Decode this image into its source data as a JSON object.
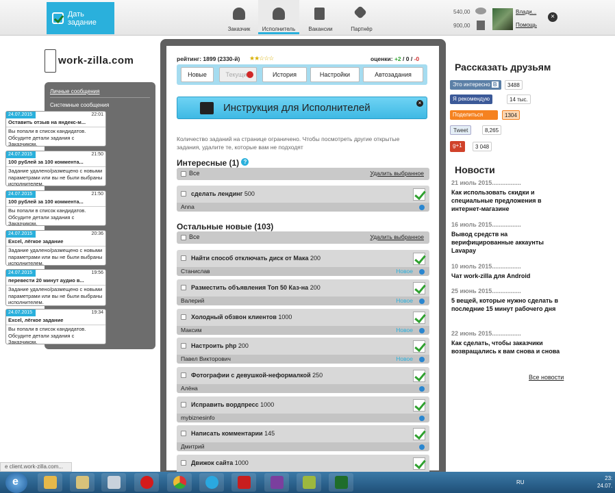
{
  "header": {
    "give_task": "Дать задание",
    "nav": [
      {
        "label": "Заказчик",
        "icon": "person-icon"
      },
      {
        "label": "Исполнитель",
        "icon": "person-icon",
        "active": true
      },
      {
        "label": "Вакансии",
        "icon": "document-icon"
      },
      {
        "label": "Партнёр",
        "icon": "handshake-icon"
      }
    ],
    "balance1": "540,00",
    "balance2": "900,00",
    "user_name": "Влади...",
    "help": "Помощь"
  },
  "logo": {
    "text": "work-zilla.com"
  },
  "messages": {
    "personal_label": "Личные сообщения",
    "system_label": "Системные сообщения",
    "items": [
      {
        "date": "24.07.2015",
        "time": "22:01",
        "title": "Оставить отзыв на яндекс-м...",
        "body": "Вы попали в список кандидатов. Обсудите детали задания с Заказчиком."
      },
      {
        "date": "24.07.2015",
        "time": "21:50",
        "title": "100 рублей за 100 коммента...",
        "body": "Задание удалено/размещено с новыми параметрами или вы не были выбраны исполнителем."
      },
      {
        "date": "24.07.2015",
        "time": "21:50",
        "title": "100 рублей за 100 коммента...",
        "body": "Вы попали в список кандидатов. Обсудите детали задания с Заказчиком."
      },
      {
        "date": "24.07.2015",
        "time": "20:36",
        "title": "Excel, лёгкое задание",
        "body": "Задание удалено/размещено с новыми параметрами или вы не были выбраны исполнителем."
      },
      {
        "date": "24.07.2015",
        "time": "19:56",
        "title": "перевести 20 минут аудио в...",
        "body": "Задание удалено/размещено с новыми параметрами или вы не были выбраны исполнителем."
      },
      {
        "date": "24.07.2015",
        "time": "19:34",
        "title": "Excel, лёгкое задание",
        "body": "Вы попали в список кандидатов. Обсудите детали задания с Заказчиком."
      }
    ]
  },
  "main": {
    "rating": "рейтинг: 1899 (2330-й)",
    "stars": "★★☆☆☆",
    "grades_label": "оценки:",
    "grade_pos": "+2",
    "grade_sep1": " / ",
    "grade_zero": "0",
    "grade_sep2": " / ",
    "grade_neg": "-0",
    "tabs": [
      "Новые",
      "Текущие",
      "История",
      "Настройки",
      "Автозадания"
    ],
    "banner": "Инструкция для Исполнителей",
    "notice": "Количество заданий на странице ограничено. Чтобы посмотреть другие открытые задания, удалите те, которые вам не подходят",
    "interesting_title": "Интересные (1)",
    "interesting_help": "?",
    "others_title": "Остальные новые (103)",
    "select_all": "Все",
    "delete_selected": "Удалить выбранное",
    "interesting": [
      {
        "name": "сделать лендинг",
        "price": "500",
        "client": "Anna",
        "new": ""
      }
    ],
    "tasks": [
      {
        "name": "Найти способ отключать диск от Мака",
        "price": "200",
        "client": "Станислав",
        "new": "Новое"
      },
      {
        "name": "Разместить объявления Топ 50 Каз-на",
        "price": "200",
        "client": "Валерий",
        "new": "Новое"
      },
      {
        "name": "Холодный обзвон клиентов",
        "price": "1000",
        "client": "Максим",
        "new": "Новое"
      },
      {
        "name": "Настроить php",
        "price": "200",
        "client": "Павел Викторович",
        "new": "Новое"
      },
      {
        "name": "Фотографии с девушкой-неформалкой",
        "price": "250",
        "client": "Алёна",
        "new": ""
      },
      {
        "name": "Исправить вордпресс",
        "price": "1000",
        "client": "mybiznesinfo",
        "new": ""
      },
      {
        "name": "Написать комментарии",
        "price": "145",
        "client": "Дмитрий",
        "new": ""
      },
      {
        "name": "Движок сайта",
        "price": "1000",
        "client": "",
        "new": ""
      }
    ]
  },
  "share": {
    "title": "Рассказать друзьям",
    "vk": "Это интересно",
    "vk_logo": "В",
    "vk_count": "3488",
    "fb": "Я рекомендую",
    "fb_count": "14 тыс.",
    "ok": "Поделиться",
    "ok_count": "1304",
    "tw": "Tweet",
    "tw_count": "8,265",
    "gp": "g+1",
    "gp_count": "3 048"
  },
  "news": {
    "title": "Новости",
    "items": [
      {
        "date": "21 июль 2015.................",
        "text": "Как использовать скидки и специальные предложения в интернет-магазине"
      },
      {
        "date": "16 июль 2015.................",
        "text": "Вывод средств на верифицированные аккаунты Lavapay"
      },
      {
        "date": "10 июль 2015.................",
        "text": "Чат work-zilla для Android"
      },
      {
        "date": "25 июнь 2015.................",
        "text": "5 вещей, которые нужно сделать в последние 15 минут рабочего дня"
      },
      {
        "date": "22 июнь 2015.................",
        "text": "Как сделать, чтобы заказчики возвращались к вам снова и снова"
      }
    ],
    "all": "Все новости"
  },
  "status_url": "e client.work-zilla.com...",
  "taskbar": {
    "lang": "RU",
    "time": "23:",
    "date": "24.07."
  },
  "colors": {
    "accent": "#2ab0dc",
    "panel": "#606060",
    "check": "#2fa12f"
  }
}
